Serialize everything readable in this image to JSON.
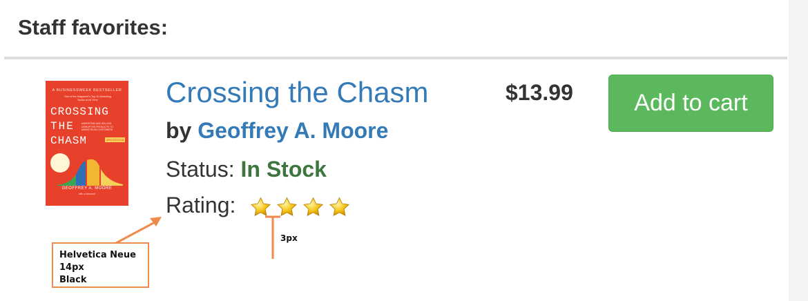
{
  "section": {
    "heading": "Staff favorites:"
  },
  "book": {
    "title": "Crossing the Chasm",
    "by_prefix": "by ",
    "author": "Geoffrey A. Moore",
    "status_label": "Status: ",
    "status_value": "In Stock",
    "rating_label": "Rating:",
    "rating_stars": 4,
    "price": "$13.99",
    "add_to_cart_label": "Add to cart"
  },
  "cover": {
    "badge": "A BUSINESSWEEK BESTSELLER",
    "tagline": "One of the Magazine's Top 10 Marketing Books of All Time",
    "title_line1": "CROSSING",
    "title_line2": "THE",
    "title_line3": "CHASM",
    "subtitle": "MARKETING AND SELLING DISRUPTIVE PRODUCTS TO MAINSTREAM CUSTOMERS",
    "edition": "3RD EDITION",
    "author": "GEOFFREY A. MOORE",
    "foreword": "with a foreword"
  },
  "annotations": {
    "font_note": [
      "Helvetica Neue",
      "14px",
      "Black"
    ],
    "star_gap": "3px"
  },
  "colors": {
    "link": "#337ab7",
    "status_green": "#3c763d",
    "button_green": "#5cb85c",
    "annotation_orange": "#f08a4b",
    "cover_red": "#e8412b"
  }
}
